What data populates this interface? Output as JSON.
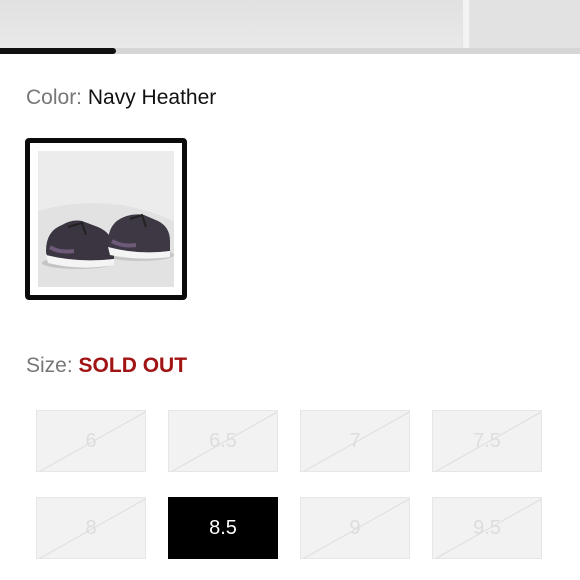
{
  "gallery": {
    "progress_fraction": 0.2
  },
  "color": {
    "label": "Color:",
    "value": "Navy Heather",
    "swatch_alt": "Navy Heather sneakers"
  },
  "size": {
    "label": "Size:",
    "status": "SOLD OUT",
    "status_color": "#a11414",
    "options": [
      {
        "label": "6",
        "available": false,
        "selected": false
      },
      {
        "label": "6.5",
        "available": false,
        "selected": false
      },
      {
        "label": "7",
        "available": false,
        "selected": false
      },
      {
        "label": "7.5",
        "available": false,
        "selected": false
      },
      {
        "label": "8",
        "available": false,
        "selected": false
      },
      {
        "label": "8.5",
        "available": true,
        "selected": true
      },
      {
        "label": "9",
        "available": false,
        "selected": false
      },
      {
        "label": "9.5",
        "available": false,
        "selected": false
      }
    ]
  }
}
